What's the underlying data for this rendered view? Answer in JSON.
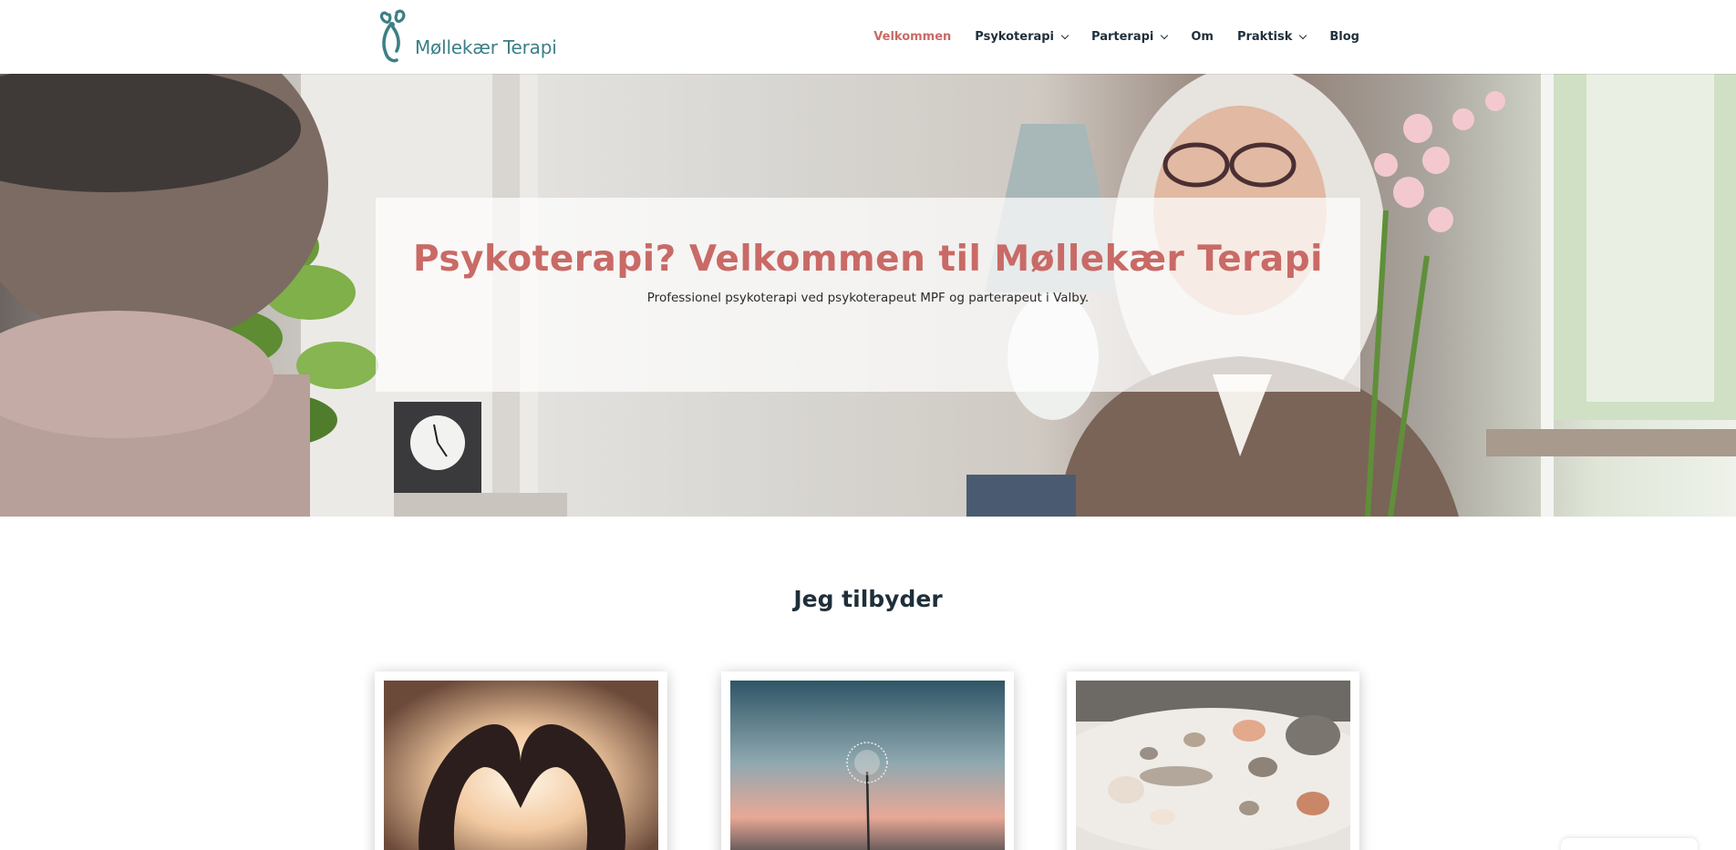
{
  "header": {
    "logo_text": "Møllekær Terapi",
    "nav": [
      {
        "label": "Velkommen",
        "active": true,
        "dropdown": false
      },
      {
        "label": "Psykoterapi",
        "active": false,
        "dropdown": true
      },
      {
        "label": "Parterapi",
        "active": false,
        "dropdown": true
      },
      {
        "label": "Om",
        "active": false,
        "dropdown": false
      },
      {
        "label": "Praktisk",
        "active": false,
        "dropdown": true
      },
      {
        "label": "Blog",
        "active": false,
        "dropdown": false
      }
    ]
  },
  "hero": {
    "title": "Psykoterapi? Velkommen til Møllekær Terapi",
    "subtitle": "Professionel psykoterapi ved psykoterapeut MPF og parterapeut i Valby."
  },
  "section": {
    "title": "Jeg tilbyder"
  },
  "colors": {
    "accent": "#c96a66",
    "brand_teal": "#3c7f86",
    "nav_text": "#1f2f3a"
  }
}
